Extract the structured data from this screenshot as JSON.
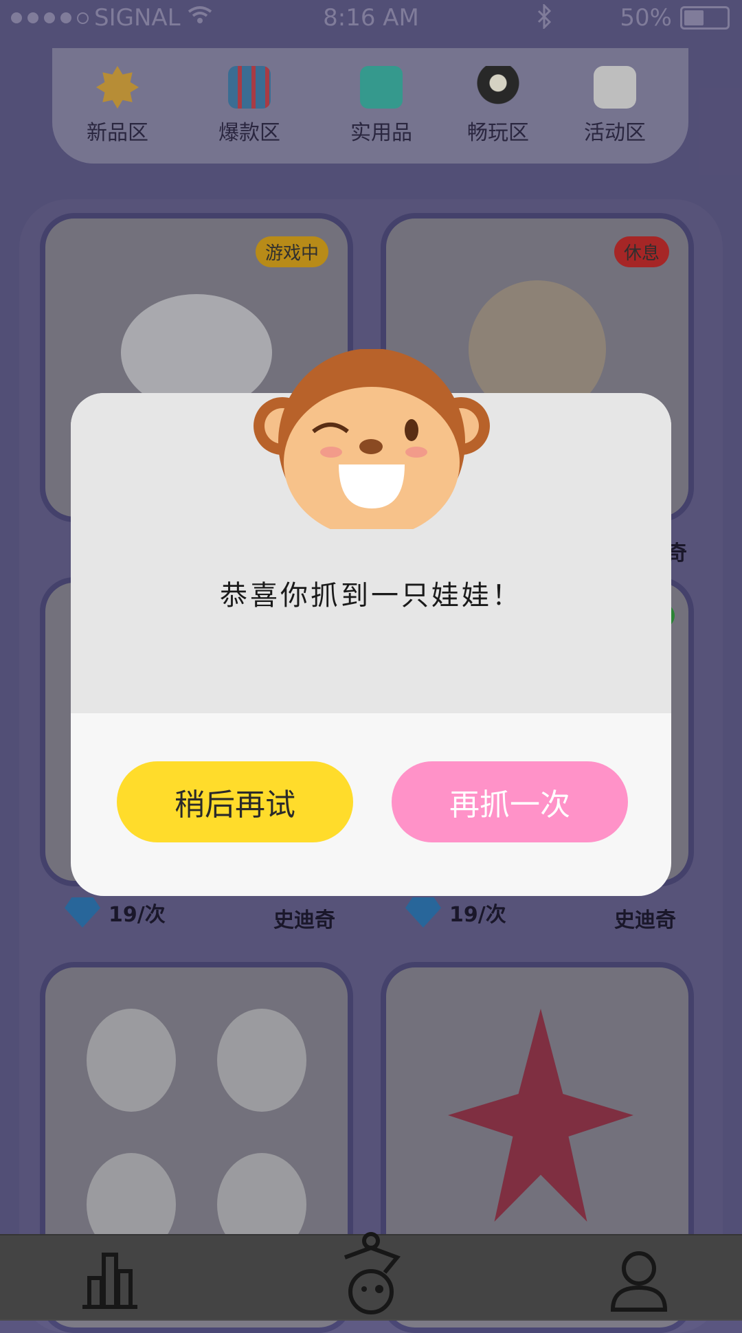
{
  "status": {
    "carrier": "SIGNAL",
    "time": "8:16 AM",
    "battery": "50%",
    "bluetooth_icon": "bluetooth-icon"
  },
  "categories": [
    {
      "label": "新品区",
      "icon": "sun-icon",
      "color": "#c79a3b"
    },
    {
      "label": "爆款区",
      "icon": "shop-icon",
      "color": "#3f77a0"
    },
    {
      "label": "实用品",
      "icon": "bag-icon",
      "color": "#3aa79a"
    },
    {
      "label": "畅玩区",
      "icon": "ufo-icon",
      "color": "#2c2c2c"
    },
    {
      "label": "活动区",
      "icon": "gamepad-icon",
      "color": "#cfcfcf"
    }
  ],
  "cards": [
    {
      "badge": "游戏中",
      "badge_color": "#c8971b"
    },
    {
      "badge": "休息",
      "badge_color": "#b52a2a"
    }
  ],
  "rows": [
    {
      "price": "19/次",
      "name": "史迪奇"
    },
    {
      "price": "19/次",
      "name": "史迪奇"
    }
  ],
  "partial_name_char": "奇",
  "dialog": {
    "message": "恭喜你抓到一只娃娃！",
    "later_label": "稍后再试",
    "again_label": "再抓一次"
  },
  "tabbar": {
    "left_icon": "ranking-icon",
    "center_icon": "claw-machine-icon",
    "right_icon": "user-profile-icon"
  }
}
